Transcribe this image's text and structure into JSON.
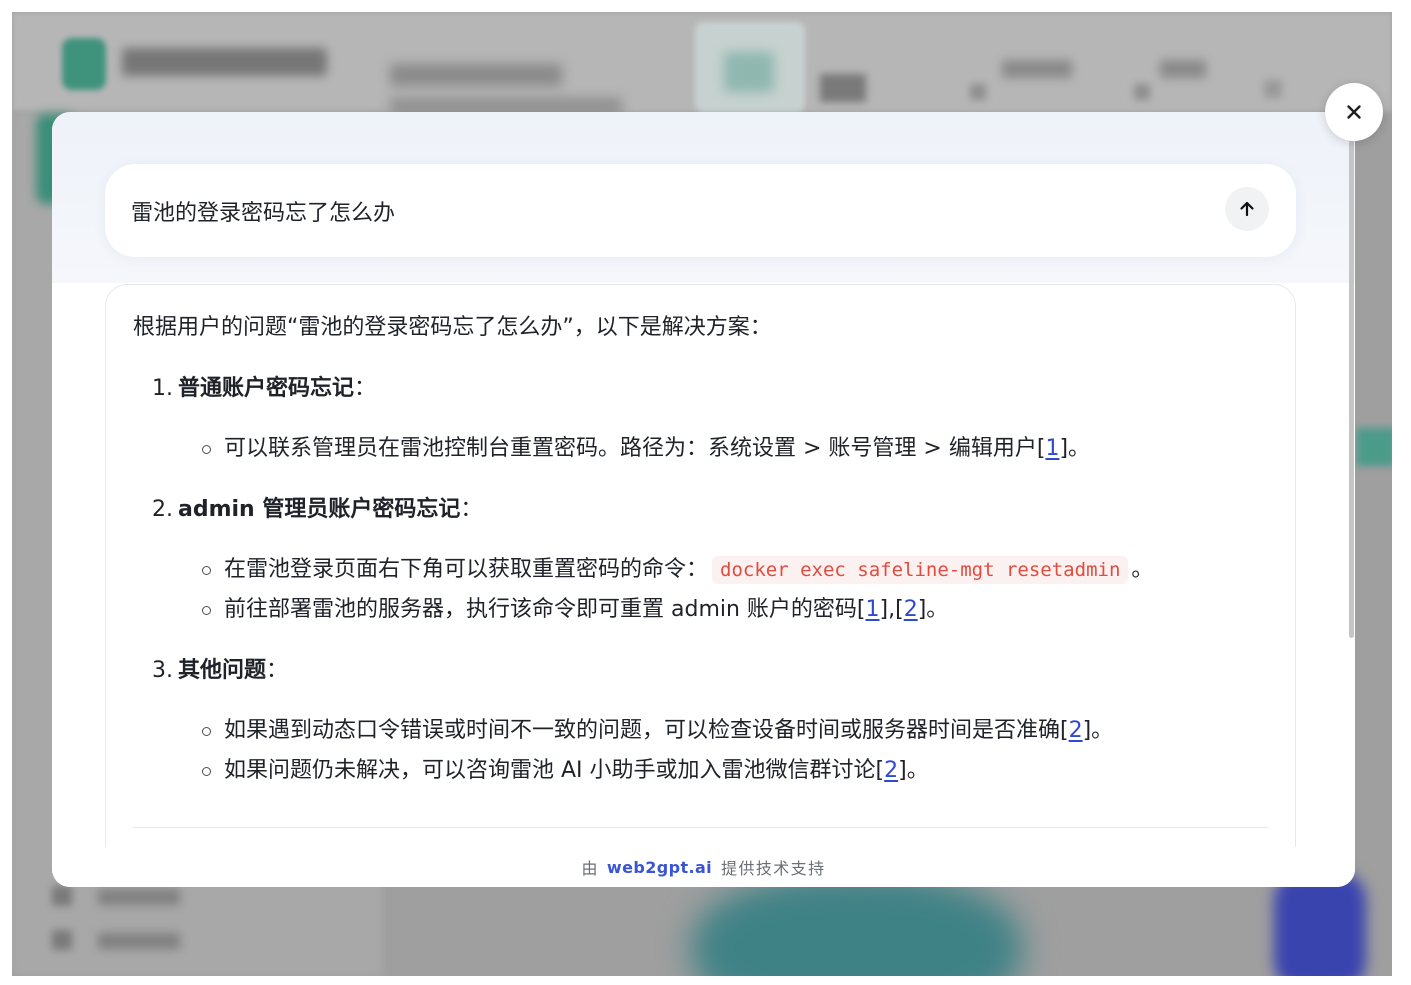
{
  "colors": {
    "text": "#1f2329",
    "brand": "#3a54d6",
    "link": "#2f49d1",
    "code_text": "#e34b3f",
    "code_bg": "#fbf1f0",
    "muted": "#6b6f76"
  },
  "modal": {
    "close_button": {
      "icon": "close-icon"
    },
    "question": {
      "text": "雷池的登录密码忘了怎么办",
      "send_icon": "arrow-up-icon"
    },
    "answer": {
      "intro": "根据用户的问题“雷池的登录密码忘了怎么办”，以下是解决方案：",
      "sections": [
        {
          "number": "1.",
          "title": "普通账户密码忘记",
          "colon": "：",
          "bullets": [
            {
              "text": "可以联系管理员在雷池控制台重置密码。路径为：系统设置 > 账号管理 > 编辑用户[",
              "ref": "1",
              "after": "]。"
            }
          ]
        },
        {
          "number": "2.",
          "title": "admin 管理员账户密码忘记",
          "colon": "：",
          "bullets": [
            {
              "text": "在雷池登录页面右下角可以获取重置密码的命令：",
              "code": "docker exec safeline-mgt resetadmin",
              "after": "。"
            },
            {
              "text": "前往部署雷池的服务器，执行该命令即可重置 admin 账户的密码[",
              "ref": "1",
              "between": "],[",
              "ref2": "2",
              "after": "]。"
            }
          ]
        },
        {
          "number": "3.",
          "title": "其他问题",
          "colon": "：",
          "bullets": [
            {
              "text": "如果遇到动态口令错误或时间不一致的问题，可以检查设备时间或服务器时间是否准确[",
              "ref": "2",
              "after": "]。"
            },
            {
              "text": "如果问题仍未解决，可以咨询雷池 AI 小助手或加入雷池微信群讨论[",
              "ref": "2",
              "after": "]。"
            }
          ]
        }
      ]
    },
    "footer": {
      "prefix": "由",
      "brand": "web2gpt.ai",
      "suffix": "提供技术支持"
    }
  }
}
